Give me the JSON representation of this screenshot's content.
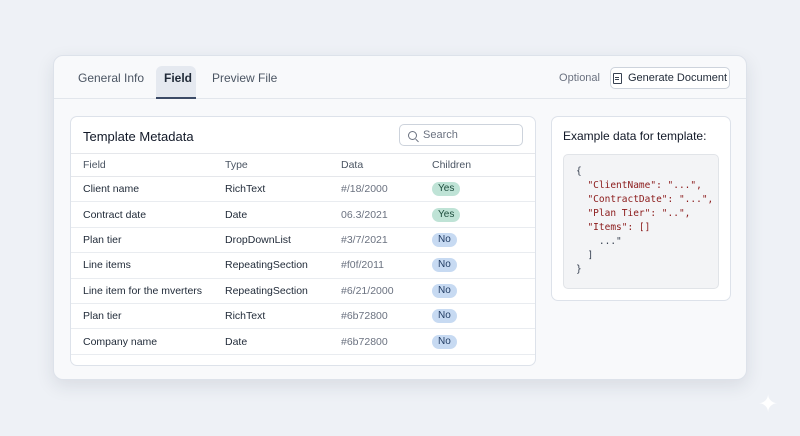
{
  "tabs": [
    {
      "label": "General Info"
    },
    {
      "label": "Field",
      "active": true
    },
    {
      "label": "Preview File"
    }
  ],
  "toolbar": {
    "optional_label": "Optional",
    "generate_label": "Generate Document"
  },
  "metadata": {
    "title": "Template Metadata",
    "search_placeholder": "Search",
    "columns": [
      "Field",
      "Type",
      "Data",
      "Children"
    ],
    "rows": [
      {
        "field": "Client name",
        "type": "RichText",
        "data": "#/18/2000",
        "children": "Yes"
      },
      {
        "field": "Contract date",
        "type": "Date",
        "data": "06.3/2021",
        "children": "Yes"
      },
      {
        "field": "Plan tier",
        "type": "DropDownList",
        "data": "#3/7/2021",
        "children": "No"
      },
      {
        "field": "Line items",
        "type": "RepeatingSection",
        "data": "#f0f/2011",
        "children": "No"
      },
      {
        "field": "Line item for the mverters",
        "type": "RepeatingSection",
        "data": "#6/21/2000",
        "children": "No"
      },
      {
        "field": "Plan tier",
        "type": "RichText",
        "data": "#6b72800",
        "children": "No"
      },
      {
        "field": "Company name",
        "type": "Date",
        "data": "#6b72800",
        "children": "No"
      }
    ]
  },
  "example": {
    "title": "Example data for template:",
    "lines": [
      "{",
      "  \"ClientName\": \"...\",",
      "  \"ContractDate\": \"...\",",
      "  \"Plan Tier\": \"..\",",
      "  \"Items\": []",
      "    ...\"",
      "  ]",
      "}"
    ]
  },
  "colors": {
    "yes_badge": "#bfe3d6",
    "no_badge": "#c7daf2",
    "accent": "#3b4a66"
  }
}
